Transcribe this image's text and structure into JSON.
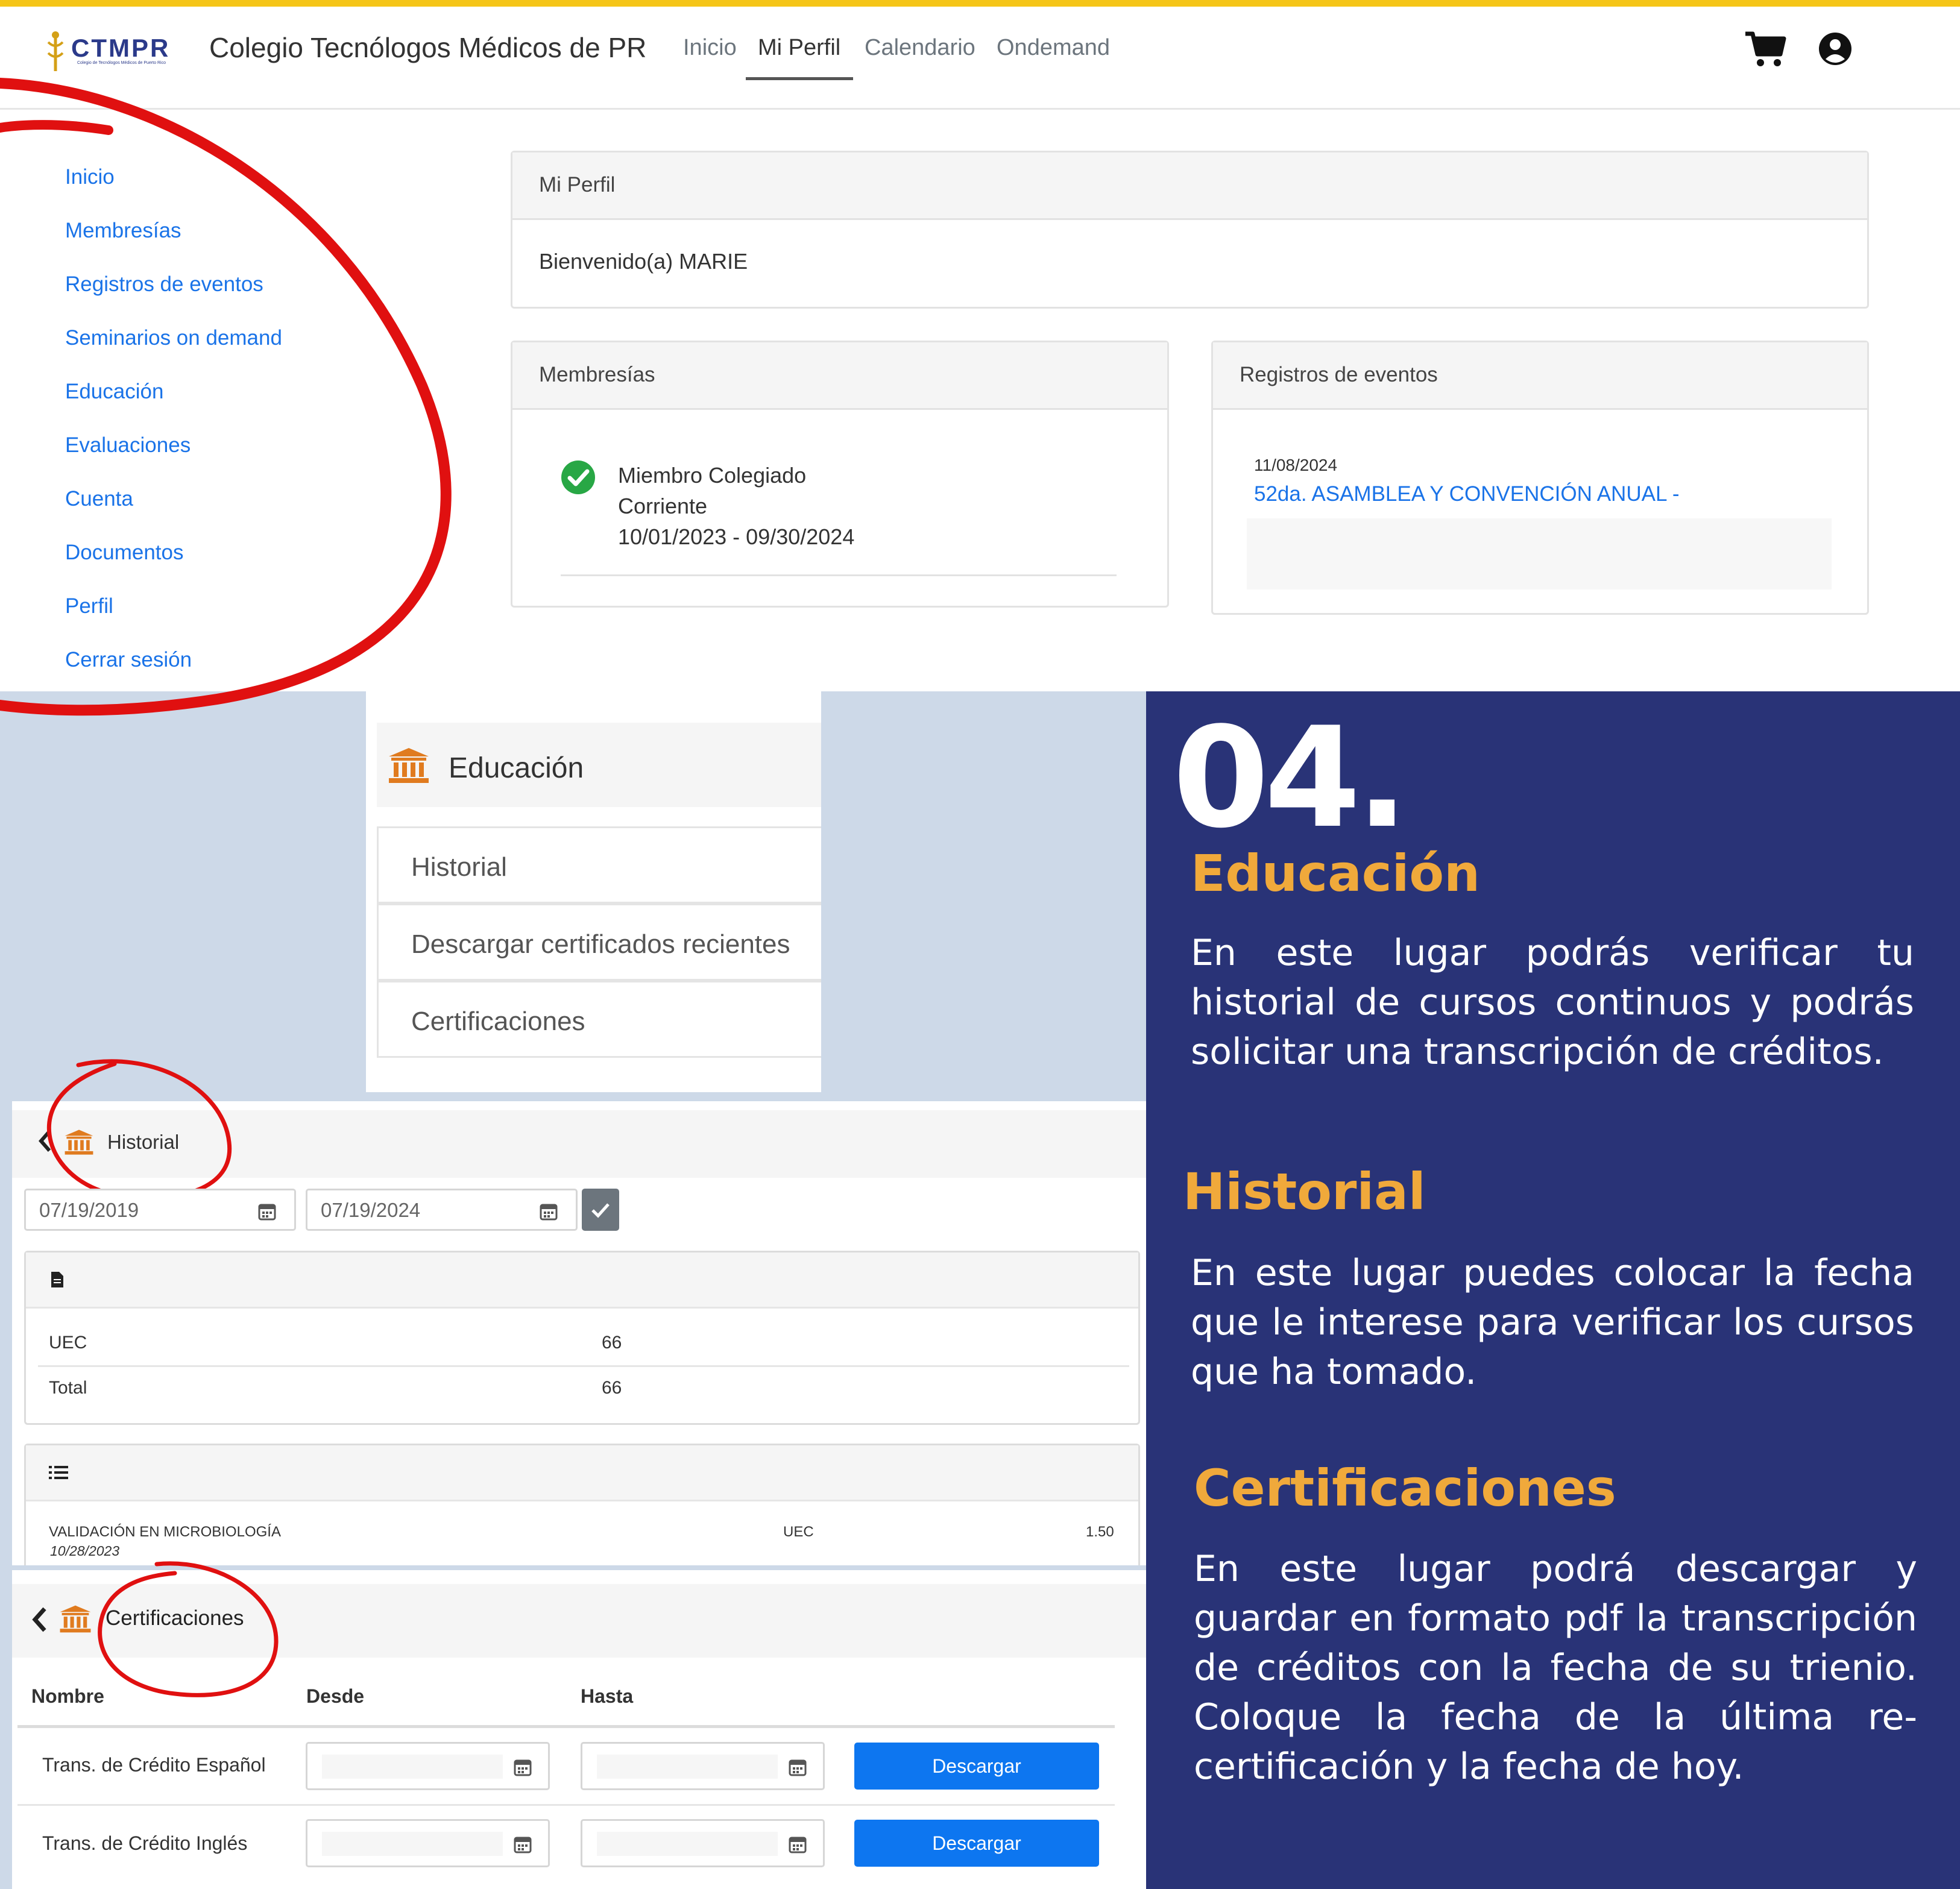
{
  "navbar": {
    "brand_logo_text": "CTMPR",
    "brand_logo_subtext": "Colegio de Tecnólogos Médicos de Puerto Rico",
    "brand_title": "Colegio Tecnólogos Médicos de PR",
    "links": [
      "Inicio",
      "Mi Perfil",
      "Calendario",
      "Ondemand"
    ],
    "active_link": "Mi Perfil",
    "cart_icon": "shopping-cart-icon",
    "user_icon": "user-circle-icon"
  },
  "sidebar": {
    "items": [
      "Inicio",
      "Membresías",
      "Registros de eventos",
      "Seminarios on demand",
      "Educación",
      "Evaluaciones",
      "Cuenta",
      "Documentos",
      "Perfil",
      "Cerrar sesión"
    ]
  },
  "profile_card": {
    "title": "Mi Perfil",
    "welcome": "Bienvenido(a) MARIE"
  },
  "membership_card": {
    "title": "Membresías",
    "line1": "Miembro Colegiado",
    "line2": "Corriente",
    "line3": "10/01/2023 - 09/30/2024",
    "status_color": "#28a745"
  },
  "events_card": {
    "title": "Registros de eventos",
    "date": "11/08/2024",
    "event": "52da. ASAMBLEA Y CONVENCIÓN ANUAL -"
  },
  "education_menu": {
    "title": "Educación",
    "icon": "bank-icon",
    "items": [
      "Historial",
      "Descargar certificados recientes",
      "Certificaciones"
    ]
  },
  "info_panel": {
    "number": "04.",
    "sections": [
      {
        "title": "Educación",
        "text": "En este lugar podrás verificar tu historial de cursos continuos y podrás solicitar una transcripción de créditos."
      },
      {
        "title": "Historial",
        "text": "En este lugar puedes colocar la fecha que le interese para verificar los cursos que ha tomado."
      },
      {
        "title": "Certificaciones",
        "text": "En este lugar podrá descargar y guardar en formato pdf la transcripción de créditos con la fecha de su trienio. Coloque la fecha de la última re-certificación y la fecha de hoy."
      }
    ],
    "accent_color": "#f0a93b",
    "background_color": "#293377"
  },
  "historial": {
    "title": "Historial",
    "date_from": "07/19/2019",
    "date_to": "07/19/2024",
    "summary": [
      {
        "label": "UEC",
        "value": "66"
      },
      {
        "label": "Total",
        "value": "66"
      }
    ],
    "courses": [
      {
        "name": "VALIDACIÓN EN MICROBIOLOGÍA",
        "date": "10/28/2023",
        "type": "UEC",
        "credits": "1.50"
      }
    ]
  },
  "certificaciones": {
    "title": "Certificaciones",
    "columns": [
      "Nombre",
      "Desde",
      "Hasta"
    ],
    "rows": [
      {
        "name": "Trans. de Crédito Español",
        "button": "Descargar"
      },
      {
        "name": "Trans. de Crédito Inglés",
        "button": "Descargar"
      }
    ],
    "button_color": "#0d76f0"
  }
}
